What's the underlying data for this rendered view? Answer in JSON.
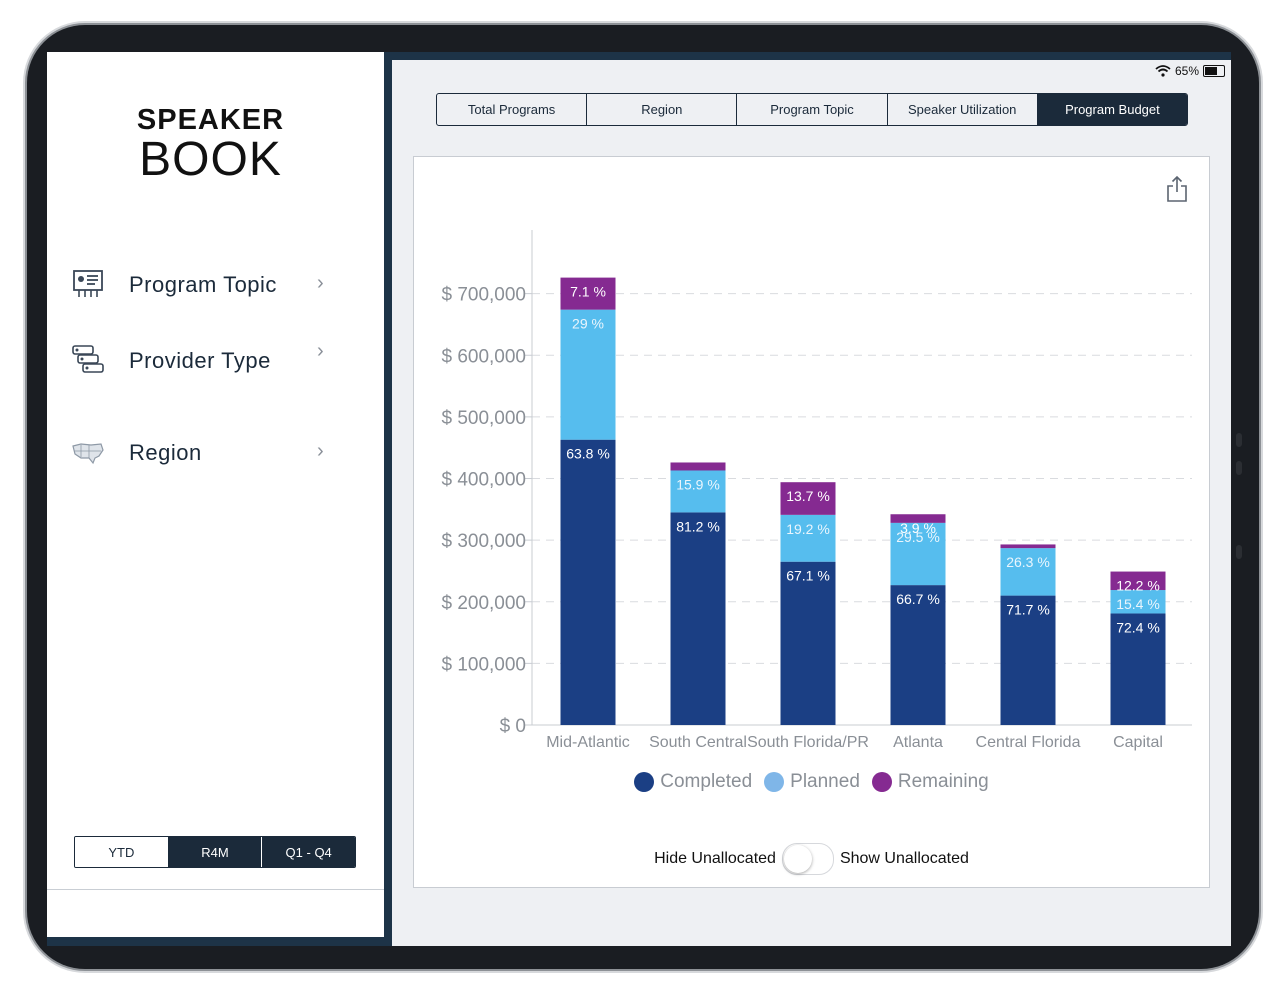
{
  "app": {
    "logo_top": "SPEAKER",
    "logo_bottom": "BOOK"
  },
  "status_bar": {
    "battery": "65%"
  },
  "sidebar": {
    "items": [
      {
        "label": "Program Topic",
        "icon": "presentation-icon"
      },
      {
        "label": "Provider Type",
        "icon": "list-cards-icon"
      },
      {
        "label": "Region",
        "icon": "us-map-icon"
      }
    ],
    "periods": [
      {
        "label": "YTD",
        "selected": false
      },
      {
        "label": "R4M",
        "selected": true
      },
      {
        "label": "Q1 - Q4",
        "selected": true
      }
    ]
  },
  "tabs": [
    {
      "label": "Total Programs",
      "active": false
    },
    {
      "label": "Region",
      "active": false
    },
    {
      "label": "Program Topic",
      "active": false
    },
    {
      "label": "Speaker Utilization",
      "active": false
    },
    {
      "label": "Program Budget",
      "active": true
    }
  ],
  "chart_data": {
    "type": "bar",
    "stacked": true,
    "categories": [
      "Mid-Atlantic",
      "South Central",
      "South Florida/PR",
      "Atlanta",
      "Central Florida",
      "Capital"
    ],
    "series": [
      {
        "name": "Completed",
        "color": "#1b3f84",
        "values": [
          463000,
          345000,
          265000,
          227000,
          210000,
          181000
        ],
        "labels": [
          "63.8 %",
          "81.2 %",
          "67.1 %",
          "66.7 %",
          "71.7 %",
          "72.4 %"
        ]
      },
      {
        "name": "Planned",
        "color": "#56bdee",
        "values": [
          211000,
          68000,
          76000,
          101000,
          77000,
          38000
        ],
        "labels": [
          "29 %",
          "15.9 %",
          "19.2 %",
          "29.5 %",
          "26.3 %",
          "15.4 %"
        ]
      },
      {
        "name": "Remaining",
        "color": "#852a91",
        "values": [
          52000,
          13000,
          53000,
          14000,
          6000,
          30000
        ],
        "labels": [
          "7.1 %",
          "",
          "13.7 %",
          "3.9 %",
          "",
          "12.2 %"
        ]
      }
    ],
    "ytick_labels": [
      "$ 0",
      "$ 100,000",
      "$ 200,000",
      "$ 300,000",
      "$ 400,000",
      "$ 500,000",
      "$ 600,000",
      "$ 700,000"
    ],
    "ylim": [
      0,
      800000
    ],
    "grid": true,
    "legend": [
      "Completed",
      "Planned",
      "Remaining"
    ],
    "legend_colors": [
      "#1b3f84",
      "#7fb6e8",
      "#852a91"
    ],
    "legend_placement": "bottom"
  },
  "toggle": {
    "left_label": "Hide Unallocated",
    "right_label": "Show Unallocated",
    "on": false
  }
}
